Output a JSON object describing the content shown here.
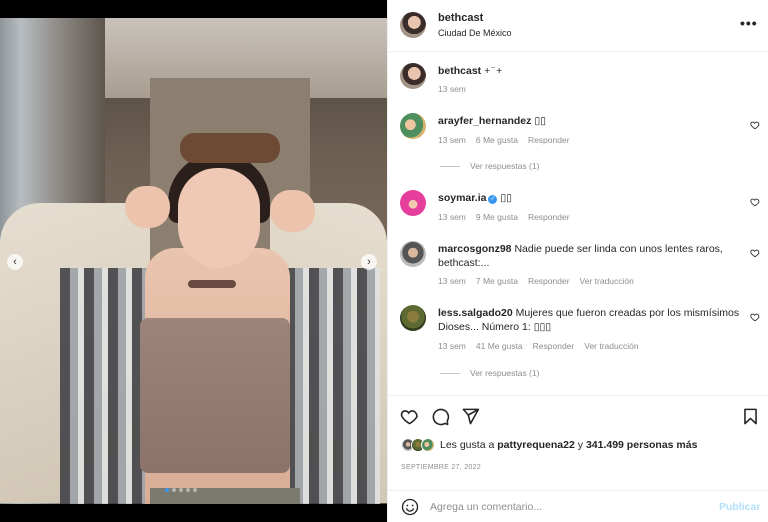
{
  "post": {
    "author": "bethcast",
    "location": "Ciudad De México",
    "more_icon": "ellipsis-icon"
  },
  "caption": {
    "username": "bethcast",
    "text": "+ ̈ +",
    "time": "13 sem"
  },
  "comments": [
    {
      "username": "arayfer_hernandez",
      "text": "▯▯",
      "time": "13 sem",
      "likes": "6 Me gusta",
      "reply": "Responder",
      "translate": "",
      "view_replies": "Ver respuestas (1)"
    },
    {
      "username": "soymar.ia",
      "text": "▯▯",
      "time": "13 sem",
      "likes": "9 Me gusta",
      "reply": "Responder",
      "translate": "",
      "verified": true
    },
    {
      "username": "marcosgonz98",
      "text": "Nadie puede ser linda con unos lentes raros, bethcast:...",
      "time": "13 sem",
      "likes": "7 Me gusta",
      "reply": "Responder",
      "translate": "Ver traducción"
    },
    {
      "username": "less.salgado20",
      "text": "Mujeres que fueron creadas por los mismísimos Dioses... Número 1: ▯▯▯",
      "time": "13 sem",
      "likes": "41 Me gusta",
      "reply": "Responder",
      "translate": "Ver traducción",
      "view_replies": "Ver respuestas (1)"
    }
  ],
  "actions": {
    "icons": [
      "heart-icon",
      "comment-icon",
      "share-icon",
      "bookmark-icon"
    ]
  },
  "likes": {
    "prefix": "Les gusta a ",
    "user": "pattyrequena22",
    "middle": " y ",
    "count": "341.499 personas más"
  },
  "date": "SEPTIEMBRE 27, 2022",
  "composer": {
    "placeholder": "Agrega un comentario...",
    "publish": "Publicar"
  },
  "colors": {
    "accent": "#3897f0",
    "publish_disabled": "#b2dffc",
    "muted": "#8e8e8e"
  }
}
